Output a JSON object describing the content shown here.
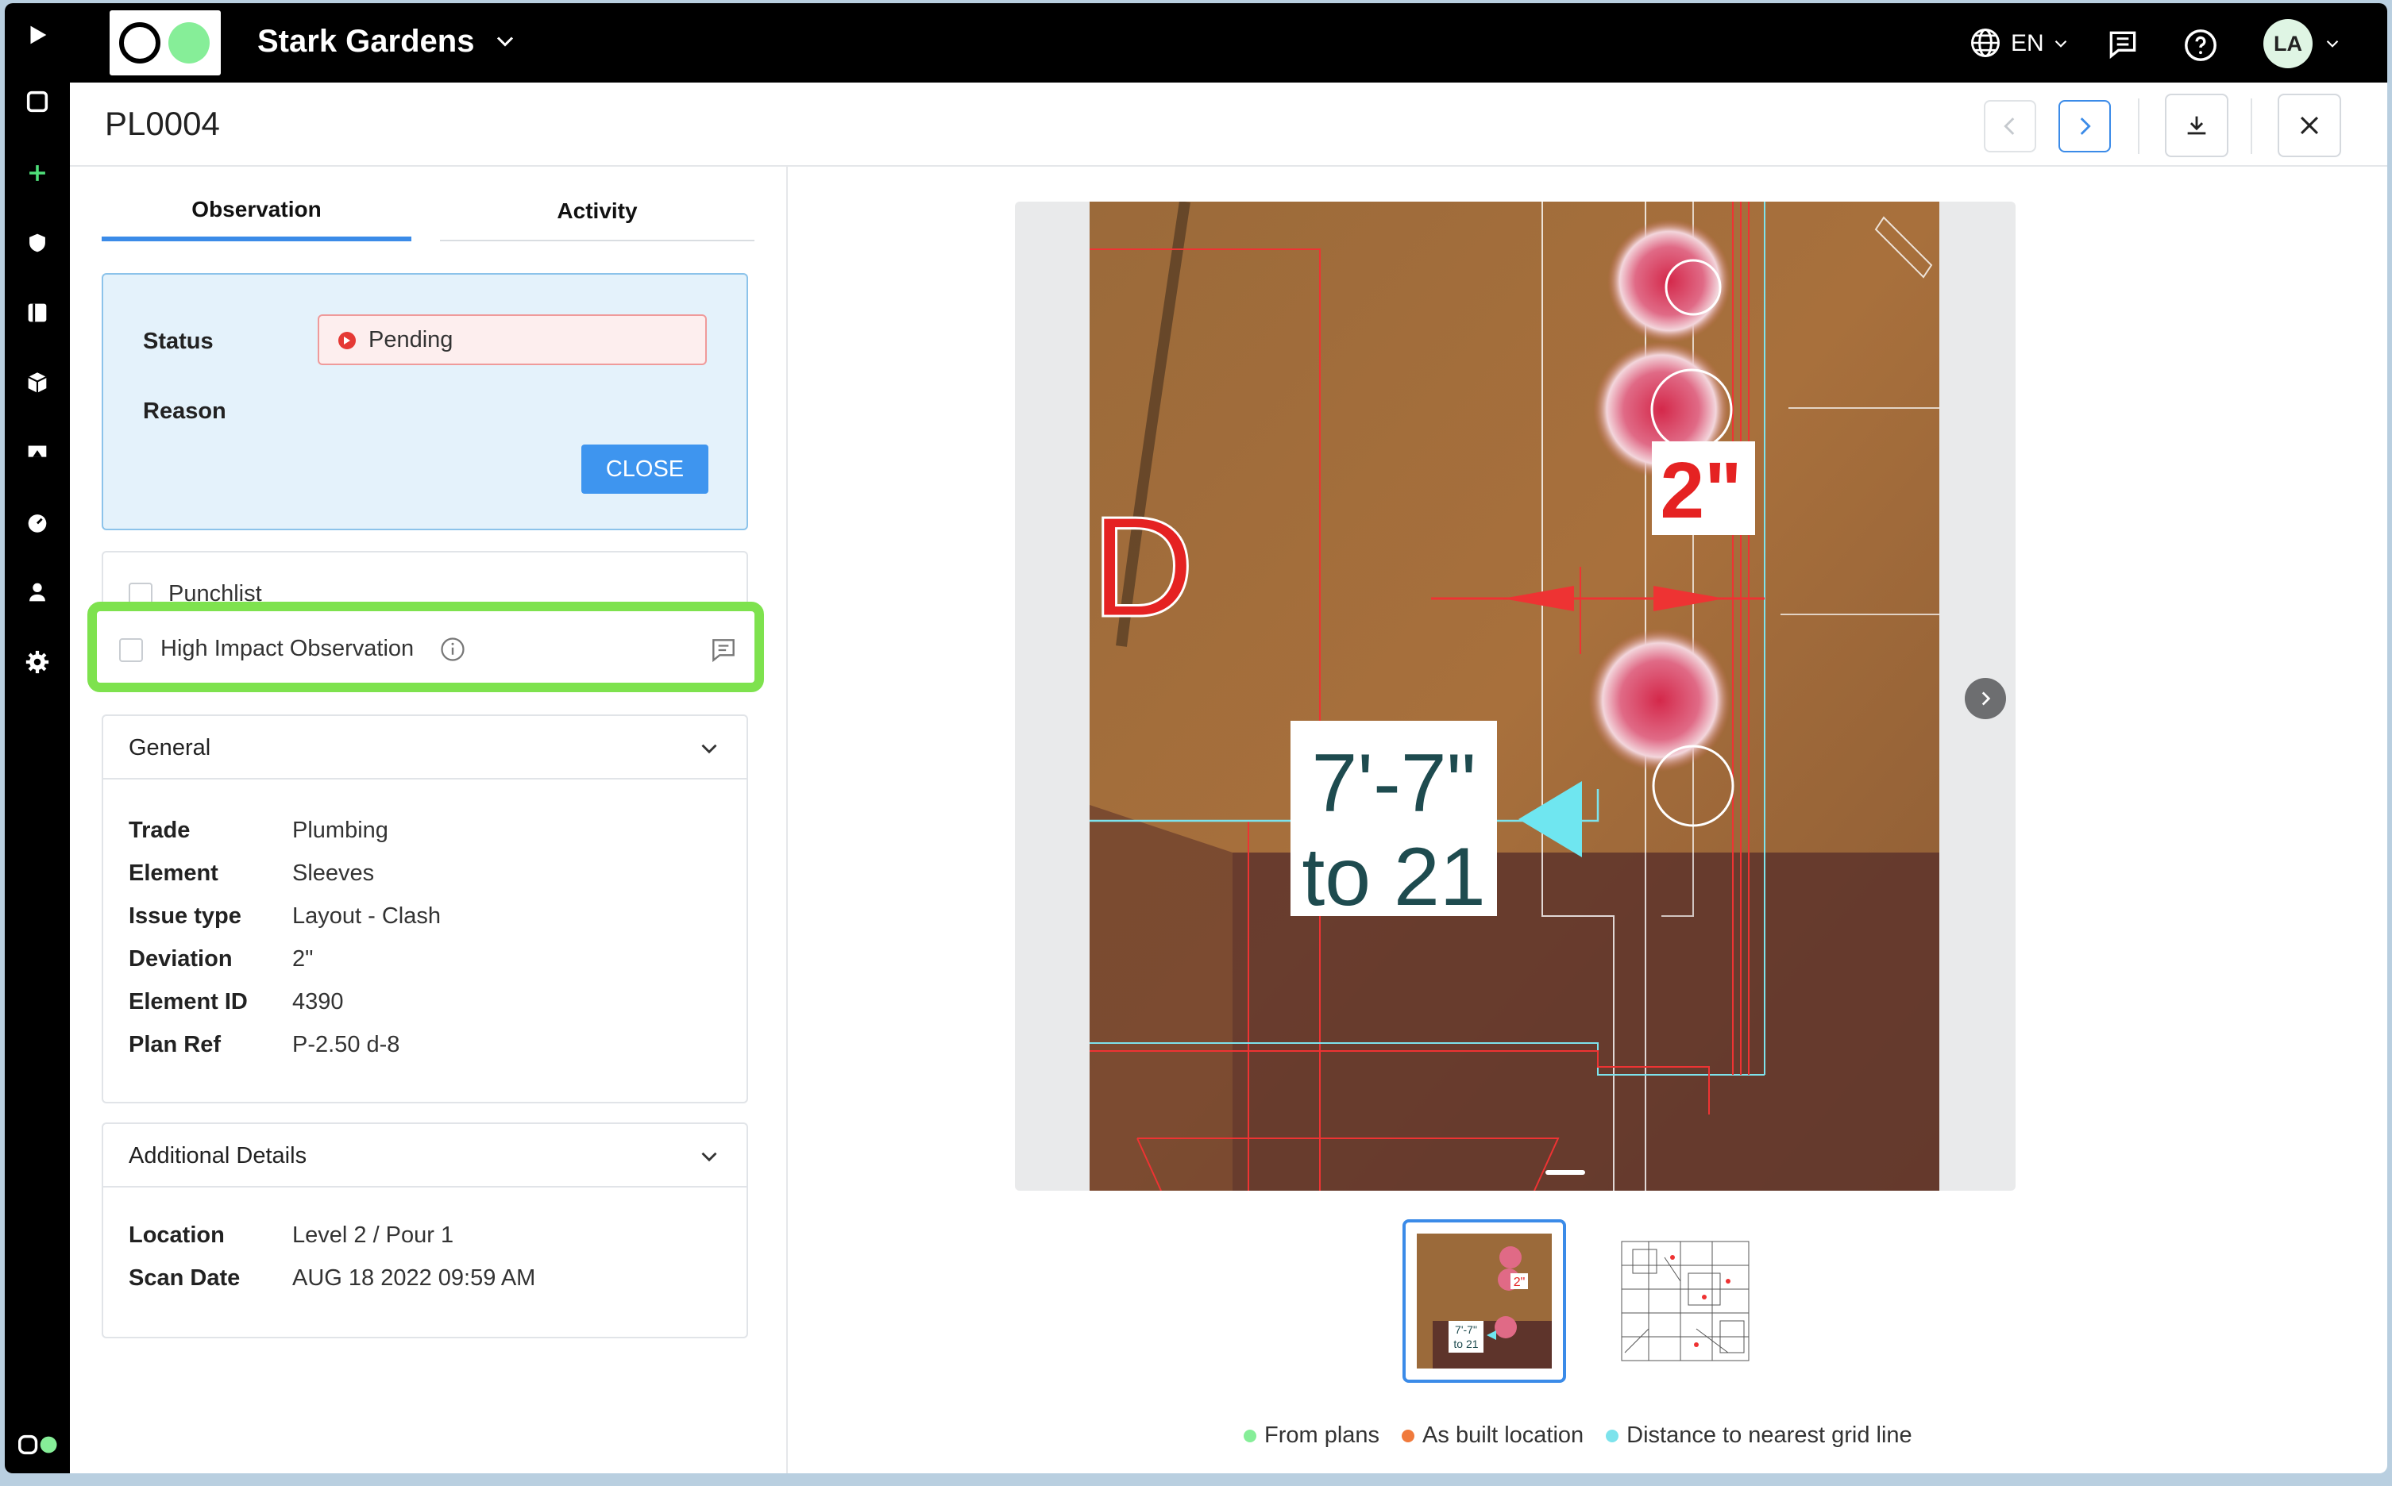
{
  "topbar": {
    "project_name": "Stark Gardens",
    "language": "EN",
    "avatar_initials": "LA"
  },
  "header": {
    "observation_id": "PL0004"
  },
  "tabs": [
    {
      "label": "Observation",
      "active": true
    },
    {
      "label": "Activity",
      "active": false
    }
  ],
  "status_box": {
    "status_label": "Status",
    "status_value": "Pending",
    "reason_label": "Reason",
    "close_button": "CLOSE"
  },
  "checks": {
    "punchlist": "Punchlist",
    "high_impact": "High Impact Observation"
  },
  "general": {
    "title": "General",
    "rows": [
      {
        "key": "Trade",
        "value": "Plumbing"
      },
      {
        "key": "Element",
        "value": "Sleeves"
      },
      {
        "key": "Issue type",
        "value": "Layout - Clash"
      },
      {
        "key": "Deviation",
        "value": "2\""
      },
      {
        "key": "Element ID",
        "value": "4390"
      },
      {
        "key": "Plan Ref",
        "value": "P-2.50 d-8"
      }
    ]
  },
  "additional": {
    "title": "Additional Details",
    "rows": [
      {
        "key": "Location",
        "value": "Level 2 / Pour 1"
      },
      {
        "key": "Scan Date",
        "value": "AUG 18 2022 09:59 AM"
      }
    ]
  },
  "viewer": {
    "labels": {
      "grid": "D",
      "deviation": "2\"",
      "distance_line1": "7'-7\"",
      "distance_line2": "to 21"
    },
    "thumbnail_labels": {
      "line1": "7'-7\"",
      "line2": "to 21",
      "deviation": "2\""
    }
  },
  "legend": [
    {
      "label": "From plans",
      "color": "#86ee98"
    },
    {
      "label": "As built location",
      "color": "#f07a3c"
    },
    {
      "label": "Distance to nearest grid line",
      "color": "#7de3ec"
    }
  ],
  "colors": {
    "accent": "#3b8be8",
    "highlight": "#7ee24e",
    "status_pending": "#e53935"
  },
  "icons": {
    "rail": [
      "play-icon",
      "square-icon",
      "plus-icon",
      "shield-icon",
      "list-icon",
      "cube-icon",
      "flag-icon",
      "dashboard-icon",
      "user-icon",
      "gear-icon"
    ]
  }
}
